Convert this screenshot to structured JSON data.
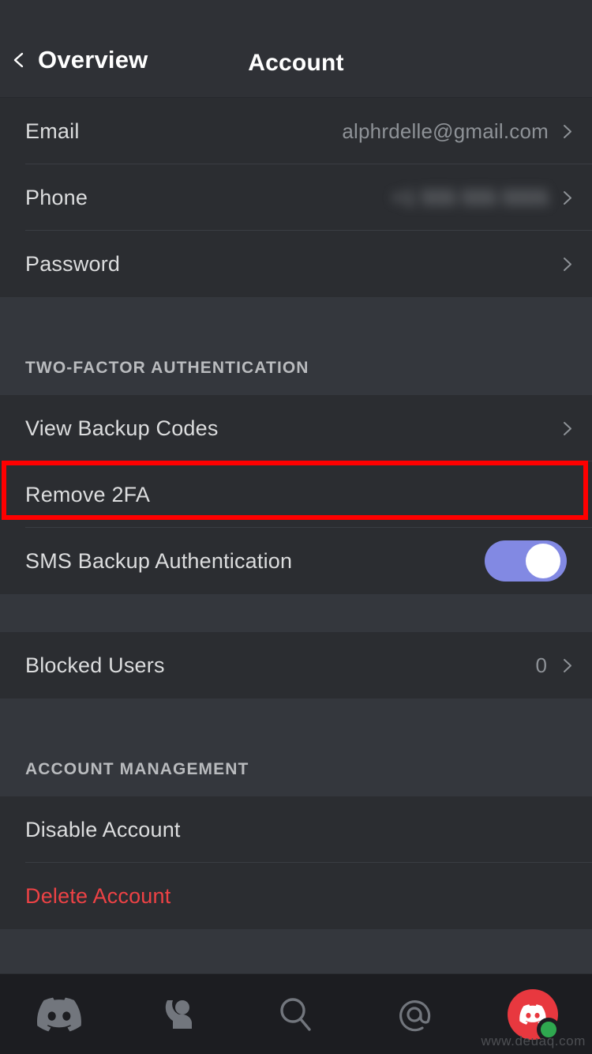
{
  "header": {
    "back_label": "Overview",
    "title": "Account",
    "back_icon": "chevron-left-icon"
  },
  "sections": [
    {
      "id": "credentials",
      "heading": null,
      "rows": [
        {
          "label": "Email",
          "value": "alphrdelle@gmail.com",
          "redacted": false,
          "accessory": "chevron-right-icon"
        },
        {
          "label": "Phone",
          "value": "+1 555 555 5555",
          "redacted": true,
          "accessory": "chevron-right-icon"
        },
        {
          "label": "Password",
          "value": "",
          "redacted": false,
          "accessory": "chevron-right-icon"
        }
      ]
    },
    {
      "id": "two-factor",
      "heading": "TWO-FACTOR AUTHENTICATION",
      "rows": [
        {
          "label": "View Backup Codes",
          "value": "",
          "redacted": false,
          "accessory": "chevron-right-icon"
        },
        {
          "label": "Remove 2FA",
          "value": "",
          "redacted": false,
          "accessory": "none",
          "highlighted": true
        },
        {
          "label": "SMS Backup Authentication",
          "value": "",
          "redacted": false,
          "accessory": "toggle",
          "toggle_on": true
        }
      ]
    },
    {
      "id": "privacy",
      "heading": null,
      "rows": [
        {
          "label": "Blocked Users",
          "value": "0",
          "redacted": false,
          "accessory": "chevron-right-icon"
        }
      ]
    },
    {
      "id": "account-management",
      "heading": "ACCOUNT MANAGEMENT",
      "rows": [
        {
          "label": "Disable Account",
          "value": "",
          "redacted": false,
          "accessory": "none"
        },
        {
          "label": "Delete Account",
          "value": "",
          "redacted": false,
          "accessory": "none",
          "danger": true
        }
      ]
    }
  ],
  "tabbar": {
    "items": [
      {
        "name": "servers-tab",
        "icon": "discord-logo-icon"
      },
      {
        "name": "friends-tab",
        "icon": "friends-person-icon"
      },
      {
        "name": "search-tab",
        "icon": "search-icon"
      },
      {
        "name": "mentions-tab",
        "icon": "at-mention-icon"
      },
      {
        "name": "profile-tab",
        "icon": "user-avatar-icon",
        "status": "online"
      }
    ]
  },
  "watermark": "www.deuaq.com",
  "colors": {
    "accent": "#8289e3",
    "danger": "#ed4245",
    "annotation": "#ff0000",
    "row_bg": "#2b2d31",
    "section_bg": "#34373d",
    "online": "#2fa84f",
    "avatar_bg": "#e8383f"
  }
}
